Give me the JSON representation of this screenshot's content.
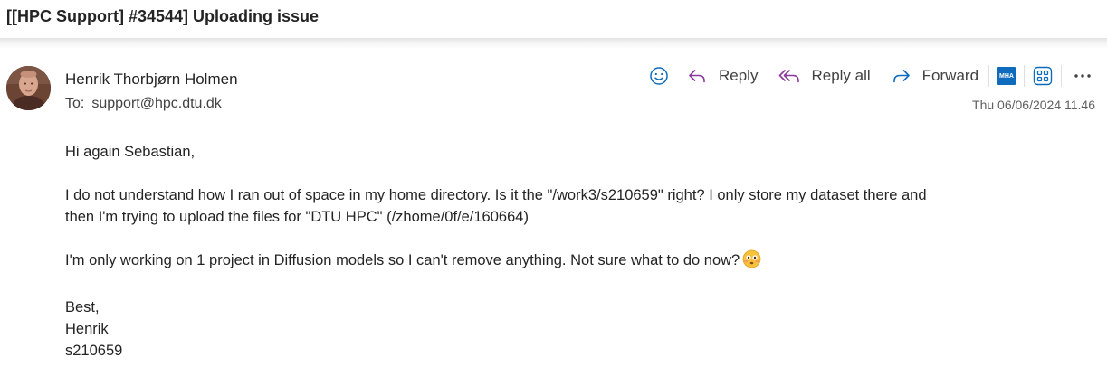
{
  "email": {
    "subject": "[[HPC Support] #34544] Uploading issue",
    "sender_name": "Henrik Thorbjørn Holmen",
    "to_label": "To:",
    "to_address": "support@hpc.dtu.dk",
    "date": "Thu 06/06/2024 11.46"
  },
  "actions": {
    "reply_label": "Reply",
    "reply_all_label": "Reply all",
    "forward_label": "Forward",
    "addin_badge": "MHA"
  },
  "body": {
    "greeting": "Hi again Sebastian,",
    "paragraph1_line1": "I do not understand how I ran out of space in my home directory. Is it the \"/work3/s210659\" right? I only store my dataset there and",
    "paragraph1_line2": "then I'm trying to upload the files for  \"DTU HPC\" (/zhome/0f/e/160664)",
    "paragraph2": "I'm only working on 1 project in Diffusion models so I can't remove anything. Not sure what to do now?",
    "signoff": "Best,",
    "signature_name": "Henrik",
    "signature_id": "s210659"
  },
  "icons": {
    "emoji_react": "smile-icon",
    "reply": "reply-arrow-icon",
    "reply_all": "reply-all-arrow-icon",
    "forward": "forward-arrow-icon",
    "addin": "mha-addin-icon",
    "apps": "apps-grid-icon",
    "more": "more-dots-icon",
    "inline_emoji": "flushed-face-emoji"
  },
  "colors": {
    "accent_blue": "#0f6cbd",
    "reply_purple": "#8b3a9c",
    "emoji_yellow": "#f9c23c"
  }
}
